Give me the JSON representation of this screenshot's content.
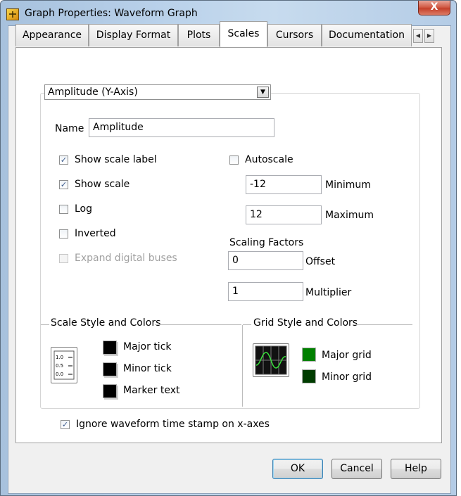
{
  "window": {
    "title": "Graph Properties: Waveform Graph",
    "close_label": "X"
  },
  "tabs": [
    {
      "label": "Appearance"
    },
    {
      "label": "Display Format"
    },
    {
      "label": "Plots"
    },
    {
      "label": "Scales",
      "active": true
    },
    {
      "label": "Cursors"
    },
    {
      "label": "Documentation"
    }
  ],
  "tab_scroll": {
    "left_icon": "chevron-left-icon",
    "right_icon": "chevron-right-icon"
  },
  "scale_selector": {
    "value": "Amplitude (Y-Axis)"
  },
  "name_field": {
    "label": "Name",
    "value": "Amplitude"
  },
  "options": {
    "show_scale_label": {
      "label": "Show scale label",
      "checked": true
    },
    "show_scale": {
      "label": "Show scale",
      "checked": true
    },
    "log": {
      "label": "Log",
      "checked": false
    },
    "inverted": {
      "label": "Inverted",
      "checked": false
    },
    "expand_digital_buses": {
      "label": "Expand digital buses",
      "checked": false,
      "disabled": true
    }
  },
  "autoscale": {
    "label": "Autoscale",
    "checked": false
  },
  "range": {
    "minimum_label": "Minimum",
    "minimum_value": "-12",
    "maximum_label": "Maximum",
    "maximum_value": "12"
  },
  "scaling": {
    "title": "Scaling Factors",
    "offset_label": "Offset",
    "offset_value": "0",
    "multiplier_label": "Multiplier",
    "multiplier_value": "1"
  },
  "scale_style": {
    "title": "Scale Style and Colors",
    "icon_ticks": [
      "1.0",
      "0.5",
      "0.0"
    ],
    "major_tick_label": "Major tick",
    "major_tick_color": "#000000",
    "minor_tick_label": "Minor tick",
    "minor_tick_color": "#000000",
    "marker_text_label": "Marker text",
    "marker_text_color": "#000000"
  },
  "grid_style": {
    "title": "Grid Style and Colors",
    "major_grid_label": "Major grid",
    "major_grid_color": "#008000",
    "minor_grid_label": "Minor grid",
    "minor_grid_color": "#003c00"
  },
  "ignore_timestamp": {
    "label": "Ignore waveform time stamp on x-axes",
    "checked": true
  },
  "buttons": {
    "ok": "OK",
    "cancel": "Cancel",
    "help": "Help"
  }
}
